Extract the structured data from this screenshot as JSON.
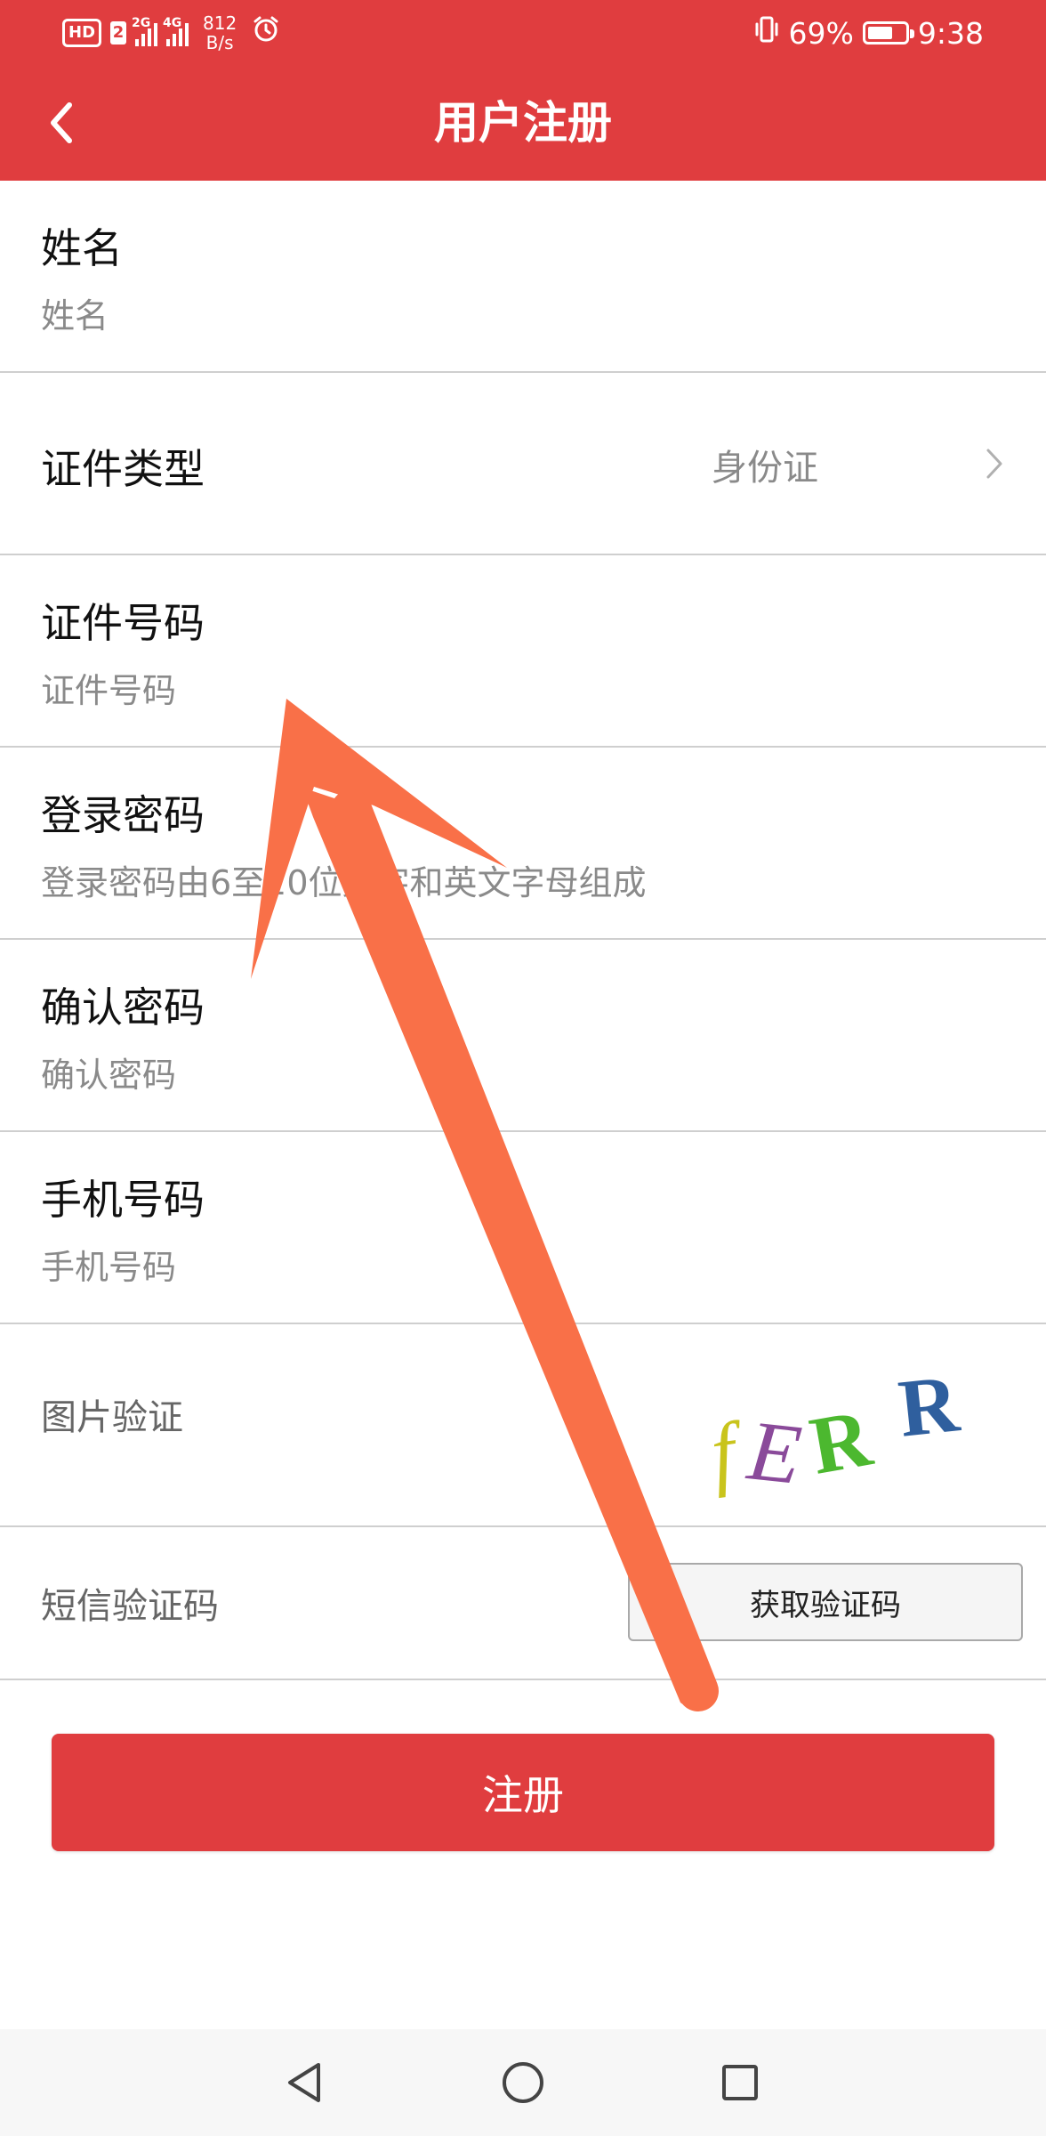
{
  "status_bar": {
    "hd": "HD",
    "sim": "2",
    "signal1_label": "2G",
    "signal2_label": "4G",
    "speed_value": "812",
    "speed_unit": "B/s",
    "battery_percent": "69%",
    "battery_level": 0.69,
    "time": "9:38",
    "icons": [
      "alarm-icon",
      "vibrate-icon",
      "battery-icon"
    ]
  },
  "header": {
    "title": "用户注册",
    "back_icon": "chevron-left-icon"
  },
  "form": {
    "name": {
      "label": "姓名",
      "placeholder": "姓名"
    },
    "id_type": {
      "label": "证件类型",
      "value": "身份证"
    },
    "id_number": {
      "label": "证件号码",
      "placeholder": "证件号码"
    },
    "password": {
      "label": "登录密码",
      "placeholder": "登录密码由6至20位数字和英文字母组成"
    },
    "confirm_password": {
      "label": "确认密码",
      "placeholder": "确认密码"
    },
    "phone": {
      "label": "手机号码",
      "placeholder": "手机号码"
    },
    "image_verify": {
      "label": "图片验证",
      "captcha_chars": [
        "f",
        "E",
        "R",
        "R"
      ],
      "captcha_colors": [
        "#c9c41c",
        "#8a4a9a",
        "#4cb82f",
        "#2f5f9e"
      ]
    },
    "sms_verify": {
      "label": "短信验证码",
      "button": "获取验证码"
    }
  },
  "register_button": "注册",
  "colors": {
    "accent": "#e03d3f",
    "annotation_arrow": "#f97048"
  },
  "nav_bar": {
    "icons": [
      "back-triangle-icon",
      "home-circle-icon",
      "recents-square-icon"
    ]
  }
}
